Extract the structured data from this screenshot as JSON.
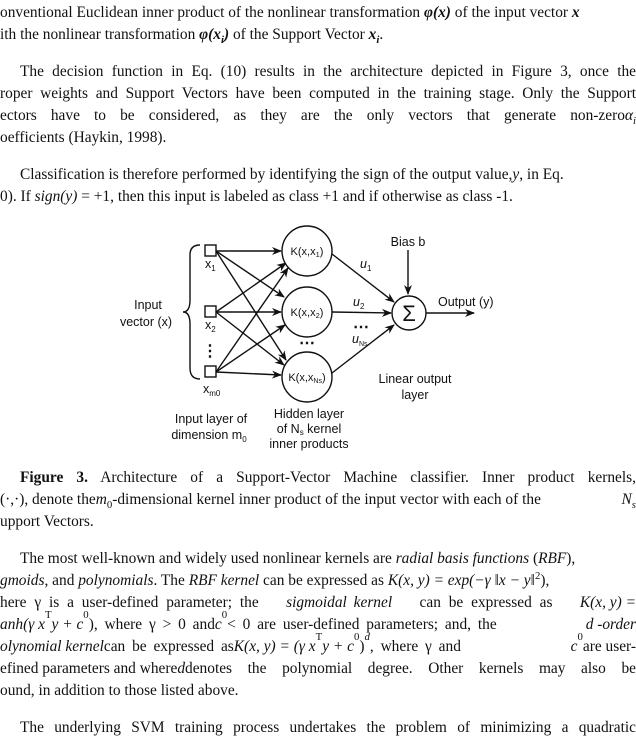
{
  "paragraph1": {
    "line1": {
      "a": "onventional Euclidean inner product of the nonlinear transformation ",
      "phi": "φ(x)",
      "b": " of the input vector ",
      "x": "x"
    },
    "line2": {
      "a": "ith the nonlinear transformation ",
      "phi": "φ(x",
      "sub": "i",
      "close": ")",
      "b": " of the Support Vector ",
      "x": "x",
      "xsub": "i",
      "end": "."
    }
  },
  "paragraph2": {
    "lines": [
      "The decision function in Eq. (10) results in the architecture depicted in Figure 3, once the",
      "roper weights and Support Vectors have been computed in the training stage. Only the Support",
      "ectors have to be considered, as they are the only vectors that generate non-zero ",
      "oefficients (Haykin, 1998)."
    ],
    "alpha": "α",
    "alpha_sub": "i"
  },
  "paragraph3": {
    "line1": "Classification is therefore performed by identifying the sign of the output value, ",
    "line1_var": "y",
    "line1_end": ", in Eq.",
    "line2_a": "0). If ",
    "line2_sign": "sign(y)",
    "line2_eq": " = +1",
    "line2_b": ", then this input is labeled as class +1 and if otherwise as class -1."
  },
  "figure": {
    "input_label_1": "Input",
    "input_label_2": "vector (x)",
    "inputs": [
      {
        "label": "x",
        "sub": "1"
      },
      {
        "label": "x",
        "sub": "2"
      },
      {
        "label": "x",
        "sub": "m0"
      }
    ],
    "vdots": "⋮",
    "hidden": [
      {
        "label": "K(x,x",
        "sub": "1",
        "close": ")"
      },
      {
        "label": "K(x,x",
        "sub": "2",
        "close": ")"
      },
      {
        "label": "K(x,x",
        "sub": "Ns",
        "close": ")"
      }
    ],
    "hidden_dots": "⋯",
    "weights": [
      {
        "label": "u",
        "sub": "1"
      },
      {
        "label": "u",
        "sub": "2"
      },
      {
        "label": "u",
        "sub": "Ns"
      }
    ],
    "weight_dots": "⋯",
    "sum_symbol": "Σ",
    "bias_label": "Bias b",
    "output_label": "Output (y)",
    "output_layer_1": "Linear output",
    "output_layer_2": "layer",
    "input_layer_1": "Input layer of",
    "input_layer_2": "dimension m",
    "input_layer_2_sub": "0",
    "hidden_layer_1": "Hidden layer",
    "hidden_layer_2a": "of N",
    "hidden_layer_2_sub": "s",
    "hidden_layer_2b": " kernel",
    "hidden_layer_3": "inner products"
  },
  "caption": {
    "label": "Figure 3.",
    "line1": " Architecture of a Support-Vector Machine classifier. Inner product kernels,",
    "line2_a": "(·,·), denote the ",
    "line2_m": "m",
    "line2_msub": "0",
    "line2_b": "-dimensional kernel inner product of the input vector with each of the ",
    "line2_N": "N",
    "line2_Nsub": "s",
    "line3": "upport Vectors."
  },
  "paragraph4": {
    "l1_a": "The most well-known and widely used nonlinear kernels are ",
    "l1_rbf": "radial basis functions",
    "l1_b": " (",
    "l1_rbf_abbr": "RBF",
    "l1_c": "),",
    "l2_a": "gmoids",
    "l2_b": ", and ",
    "l2_poly": "polynomials",
    "l2_c": ". The ",
    "l2_rbfk": "RBF kernel",
    "l2_d": " can be expressed as ",
    "l2_eq": "K(x, y) = exp(−γ ‖x − y‖",
    "l2_sup": "2",
    "l2_end": "),",
    "l3_a": "here γ is a user-defined parameter; the ",
    "l3_sig": "sigmoidal kernel",
    "l3_b": " can be expressed as ",
    "l3_eq": "K(x, y) =",
    "l4_a": "anh(γ x",
    "l4_T": "T",
    "l4_b": "y + c",
    "l4_sub": "0",
    "l4_c": "), where γ > 0 and ",
    "l4_c0": "c",
    "l4_c0sub": "0",
    "l4_d": " < 0 are user-defined parameters; and, the ",
    "l4_order": "d -order",
    "l5_a": "olynomial kernel",
    "l5_b": " can be expressed as ",
    "l5_eq": "K(x, y) = (γ x",
    "l5_T": "T",
    "l5_c": "y + c",
    "l5_sub": "0",
    "l5_close": ")",
    "l5_d": "d",
    "l5_e": ", where γ and ",
    "l5_c0": "c",
    "l5_c0sub": "0",
    "l5_f": " are user-",
    "l6_a": "efined parameters and where ",
    "l6_d": "d",
    "l6_b": " denotes the polynomial degree. Other kernels may also be",
    "l7": "ound, in addition to those listed above."
  },
  "paragraph5": {
    "line1": "The underlying SVM training process undertakes the problem of minimizing a quadratic"
  }
}
